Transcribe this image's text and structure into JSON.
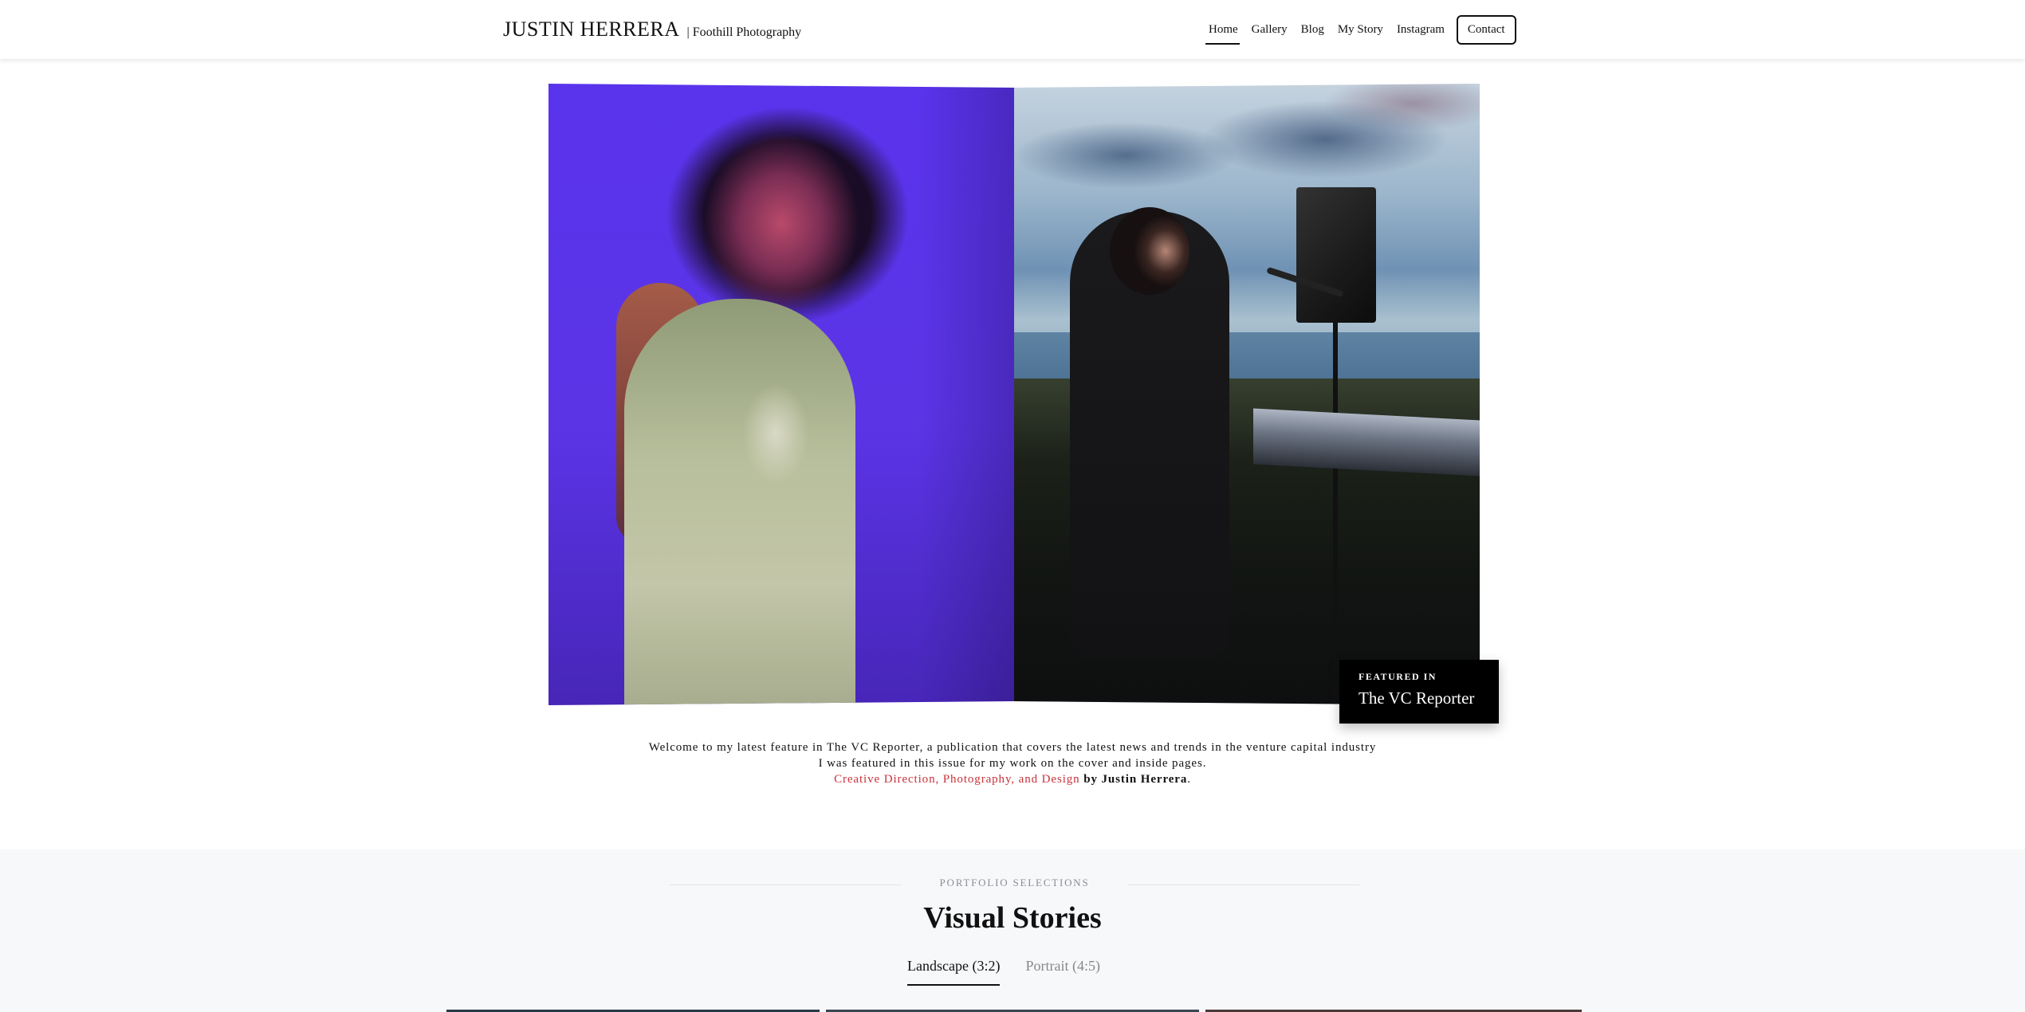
{
  "header": {
    "brand_name": "JUSTIN HERRERA",
    "brand_tagline": "| Foothill Photography",
    "nav": [
      {
        "label": "Home",
        "active": true
      },
      {
        "label": "Gallery",
        "active": false
      },
      {
        "label": "Blog",
        "active": false
      },
      {
        "label": "My Story",
        "active": false
      },
      {
        "label": "Instagram",
        "active": false
      }
    ],
    "contact_label": "Contact"
  },
  "hero": {
    "badge_kicker": "FEATURED IN",
    "badge_title": "The VC Reporter"
  },
  "intro": {
    "line1": "Welcome to my latest feature in The VC Reporter, a publication that covers the latest news and trends in the venture capital industry",
    "line2": "I was featured in this issue for my work on the cover and inside pages.",
    "credit_link": "Creative Direction, Photography, and Design",
    "credit_by": "by Justin Herrera",
    "credit_end": "."
  },
  "portfolio": {
    "eyebrow": "PORTFOLIO SELECTIONS",
    "title": "Visual Stories",
    "tabs": [
      {
        "label": "Landscape (3:2)",
        "active": true
      },
      {
        "label": "Portrait (4:5)",
        "active": false
      }
    ]
  },
  "colors": {
    "accent_red": "#c8323a",
    "section_bg": "#f7f8fa",
    "badge_bg": "#000000"
  }
}
